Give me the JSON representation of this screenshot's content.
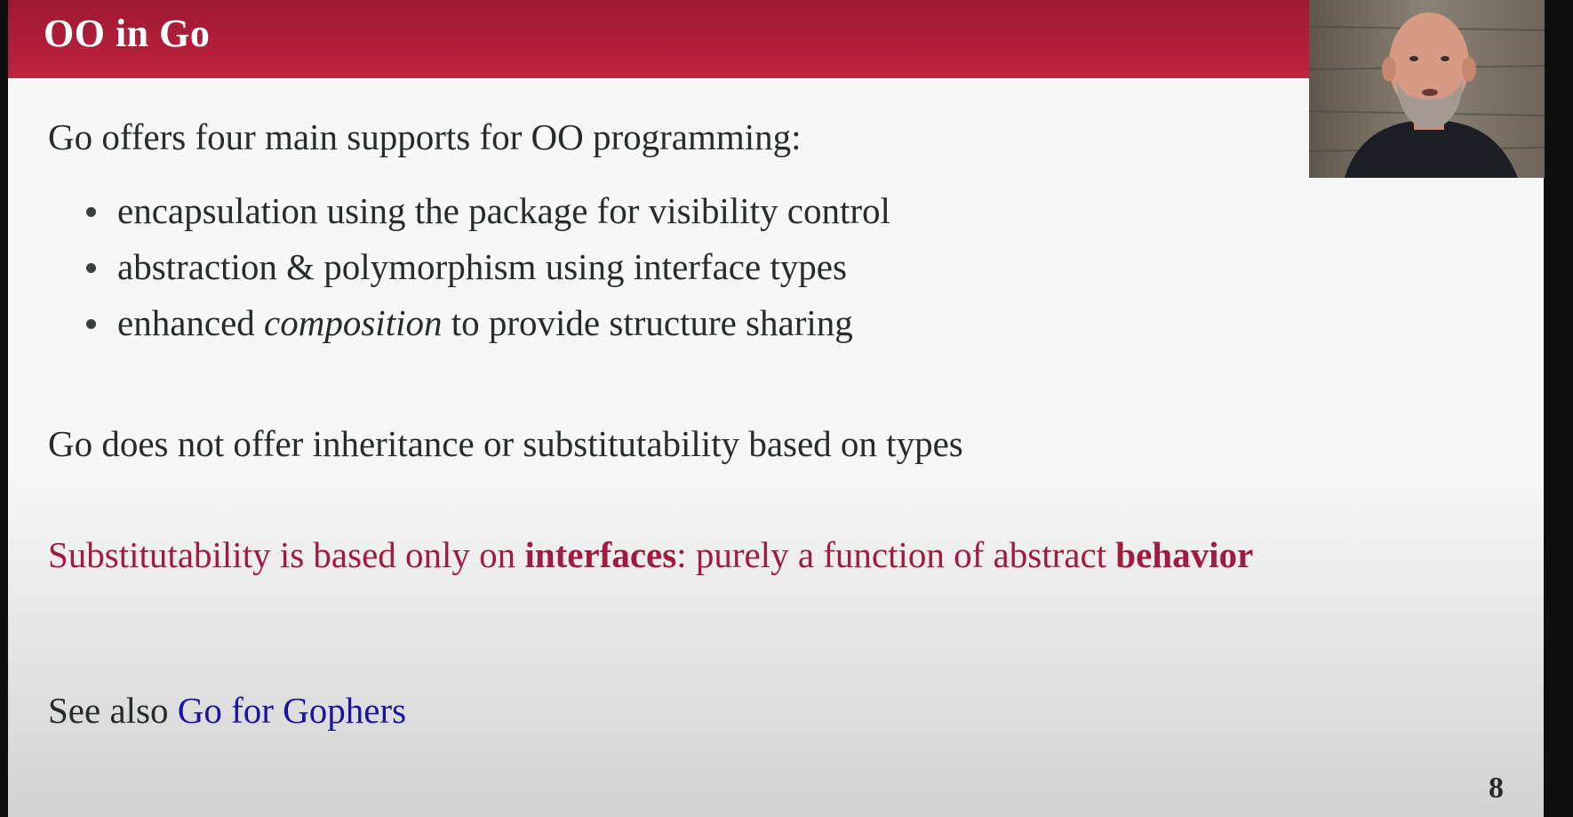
{
  "slide": {
    "title": "OO in Go",
    "intro": "Go offers four main supports for OO programming:",
    "bullets": [
      {
        "before": "encapsulation using the package for visibility control",
        "em": "",
        "after": ""
      },
      {
        "before": "abstraction & polymorphism using interface types",
        "em": "",
        "after": ""
      },
      {
        "before": "enhanced ",
        "em": "composition",
        "after": " to provide structure sharing"
      }
    ],
    "negation": "Go does not offer inheritance or substitutability based on types",
    "highlight": {
      "part1": "Substitutability is based only on ",
      "bold1": "interfaces",
      "part2": ": purely a function of abstract ",
      "bold2": "behavior"
    },
    "see_also": {
      "prefix": "See also ",
      "link": "Go for Gophers"
    },
    "page_number": "8"
  },
  "colors": {
    "title_bar": "#bf2341",
    "highlight_text": "#a01b40",
    "link_text": "#1a14a0",
    "body_text": "#262b2b"
  },
  "webcam": {
    "icon": "presenter-video-feed"
  }
}
